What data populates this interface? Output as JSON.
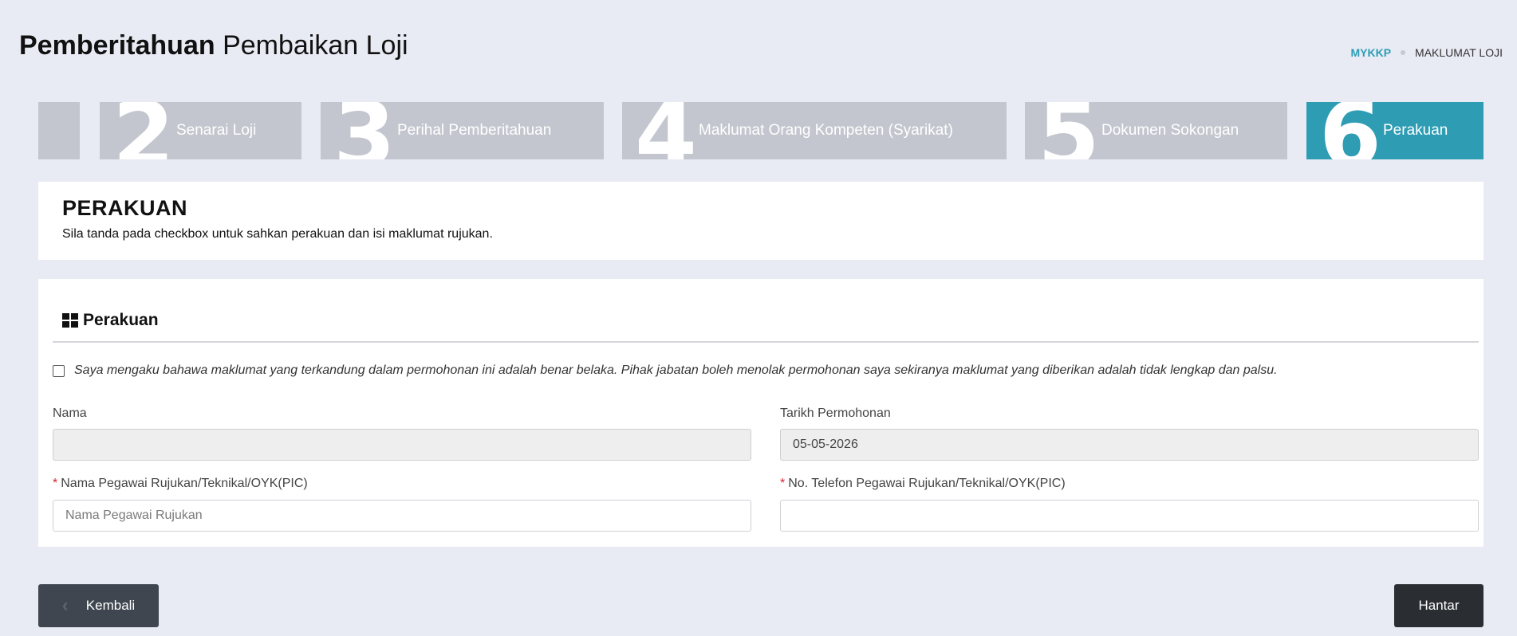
{
  "header": {
    "title_bold": "Pemberitahuan",
    "title_light": "Pembaikan Loji"
  },
  "breadcrumb": {
    "link": "MYKKP",
    "current": "MAKLUMAT LOJI"
  },
  "steps": [
    {
      "num": "",
      "label": ""
    },
    {
      "num": "2",
      "label": "Senarai Loji"
    },
    {
      "num": "3",
      "label": "Perihal Pemberitahuan"
    },
    {
      "num": "4",
      "label": "Maklumat Orang Kompeten (Syarikat)"
    },
    {
      "num": "5",
      "label": "Dokumen Sokongan"
    },
    {
      "num": "6",
      "label": "Perakuan",
      "active": true
    }
  ],
  "intro": {
    "title": "PERAKUAN",
    "subtitle": "Sila tanda pada checkbox untuk sahkan perakuan dan isi maklumat rujukan."
  },
  "form": {
    "section_title": "Perakuan",
    "declaration": "Saya mengaku bahawa maklumat yang terkandung dalam permohonan ini adalah benar belaka. Pihak jabatan boleh menolak permohonan saya sekiranya maklumat yang diberikan adalah tidak lengkap dan palsu.",
    "declaration_checked": false,
    "nama_label": "Nama",
    "nama_value": "",
    "tarikh_label": "Tarikh Permohonan",
    "tarikh_value": "05-05-2026",
    "pic_label": "Nama Pegawai Rujukan/Teknikal/OYK(PIC)",
    "pic_placeholder": "Nama Pegawai Rujukan",
    "phone_label": "No. Telefon Pegawai Rujukan/Teknikal/OYK(PIC)",
    "phone_value": "",
    "required_mark": "*"
  },
  "buttons": {
    "back": "Kembali",
    "submit": "Hantar"
  },
  "colors": {
    "accent": "#2e9db4",
    "step_inactive": "#c4c6cf",
    "background": "#e9ebf4",
    "required": "#d9232e"
  }
}
